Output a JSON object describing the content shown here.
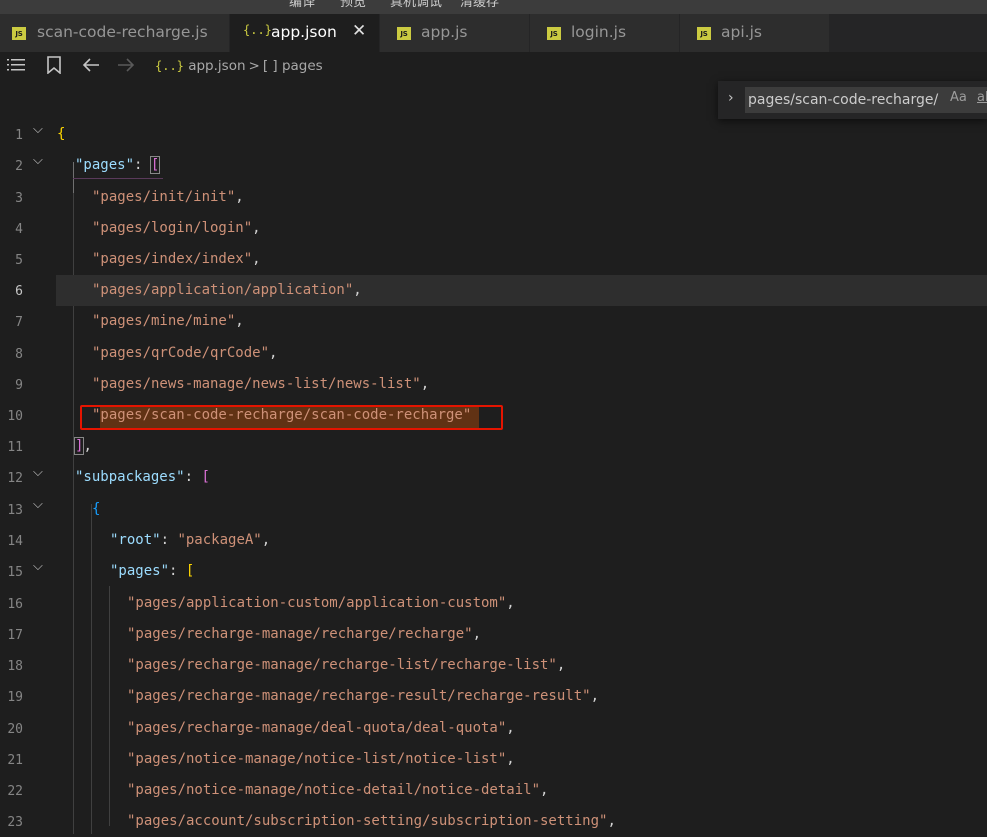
{
  "menu": {
    "items": [
      "编译",
      "预览",
      "真机调试",
      "清缓存"
    ]
  },
  "tabs": [
    {
      "label": "scan-code-recharge.js",
      "icon": "JS",
      "active": false
    },
    {
      "label": "app.json",
      "icon": "{..}",
      "active": true
    },
    {
      "label": "app.js",
      "icon": "JS",
      "active": false
    },
    {
      "label": "login.js",
      "icon": "JS",
      "active": false
    },
    {
      "label": "api.js",
      "icon": "JS",
      "active": false
    }
  ],
  "tab_close_glyph": "✕",
  "breadcrumb": {
    "file": "app.json",
    "file_icon": "{..}",
    "separator": ">",
    "symbol_icon": "[ ]",
    "symbol": "pages"
  },
  "find": {
    "value": "pages/scan-code-recharge/",
    "match_case_label": "Aa",
    "whole_word_label": "ab"
  },
  "current_line": 6,
  "lines": [
    {
      "n": "1",
      "fold": true
    },
    {
      "n": "2",
      "fold": true
    },
    {
      "n": "3"
    },
    {
      "n": "4"
    },
    {
      "n": "5"
    },
    {
      "n": "6"
    },
    {
      "n": "7"
    },
    {
      "n": "8"
    },
    {
      "n": "9"
    },
    {
      "n": "10"
    },
    {
      "n": "11"
    },
    {
      "n": "12",
      "fold": true
    },
    {
      "n": "13",
      "fold": true
    },
    {
      "n": "14"
    },
    {
      "n": "15",
      "fold": true
    },
    {
      "n": "16"
    },
    {
      "n": "17"
    },
    {
      "n": "18"
    },
    {
      "n": "19"
    },
    {
      "n": "20"
    },
    {
      "n": "21"
    },
    {
      "n": "22"
    },
    {
      "n": "23"
    }
  ],
  "code": {
    "open_brace": "{",
    "pages_key": "\"pages\"",
    "colon": ": ",
    "open_bracket": "[",
    "close_bracket": "]",
    "comma": ",",
    "pages_list": [
      "\"pages/init/init\"",
      "\"pages/login/login\"",
      "\"pages/index/index\"",
      "\"pages/application/application\"",
      "\"pages/mine/mine\"",
      "\"pages/qrCode/qrCode\"",
      "\"pages/news-manage/news-list/news-list\"",
      "\"pages/scan-code-recharge/scan-code-recharge\""
    ],
    "subpackages_key": "\"subpackages\"",
    "root_key": "\"root\"",
    "root_value": "\"packageA\"",
    "sub_pages_key": "\"pages\"",
    "sub_pages_list": [
      "\"pages/application-custom/application-custom\"",
      "\"pages/recharge-manage/recharge/recharge\"",
      "\"pages/recharge-manage/recharge-list/recharge-list\"",
      "\"pages/recharge-manage/recharge-result/recharge-result\"",
      "\"pages/recharge-manage/deal-quota/deal-quota\"",
      "\"pages/notice-manage/notice-list/notice-list\"",
      "\"pages/notice-manage/notice-detail/notice-detail\"",
      "\"pages/account/subscription-setting/subscription-setting\""
    ]
  },
  "colors": {
    "editor_bg": "#1e1e1e",
    "key": "#9cdcfe",
    "string": "#ce9178",
    "bracket_gold": "#ffd700",
    "bracket_purple": "#da70d6",
    "highlight_box": "#e51400",
    "js_badge": "#cbcb41"
  }
}
